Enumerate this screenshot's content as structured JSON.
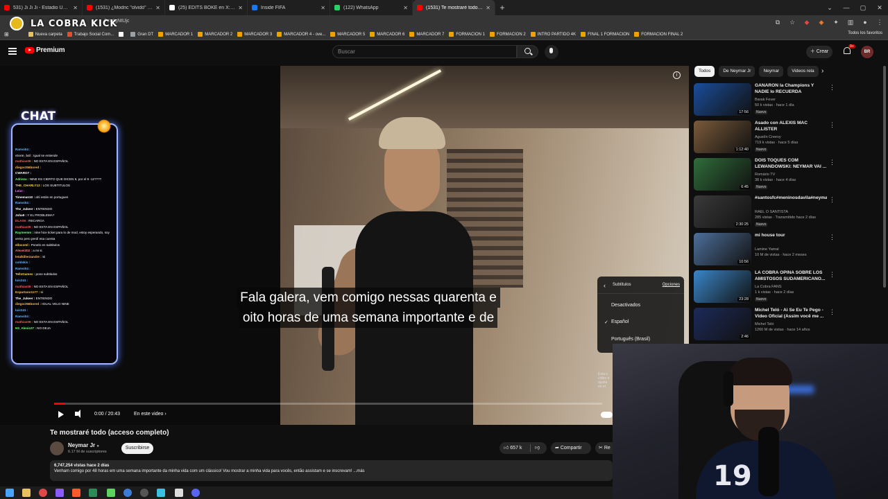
{
  "browser": {
    "tabs": [
      {
        "title": "531) Ji Ji Ji - Estadio Único de",
        "favicon_color": "#ff0000",
        "active": false
      },
      {
        "title": "(1531) ¿Modric \"olvidó\" al Madr",
        "favicon_color": "#ff0000",
        "active": false
      },
      {
        "title": "(25) EDITS BOKE en X: \"Los ocho",
        "favicon_color": "#ffffff",
        "active": false
      },
      {
        "title": "Inside FIFA",
        "favicon_color": "#1877f2",
        "active": false
      },
      {
        "title": "(122) WhatsApp",
        "favicon_color": "#25d366",
        "active": false
      },
      {
        "title": "(1531) Te mostraré todo (acceso",
        "favicon_color": "#ff0000",
        "active": true
      }
    ],
    "url_fragment": "?v=4gNtUjc",
    "bookmarks": [
      {
        "label": "Nueva carpeta",
        "color": "#e8c060"
      },
      {
        "label": "Trabajo Social Com...",
        "color": "#e0502c"
      },
      {
        "label": "",
        "color": "#ffffff"
      },
      {
        "label": "Gran DT",
        "color": "#9aa0a6"
      },
      {
        "label": "MARCADOR 1",
        "color": "#f0a000"
      },
      {
        "label": "MARCADOR 2",
        "color": "#f0a000"
      },
      {
        "label": "MARCADOR 3",
        "color": "#f0a000"
      },
      {
        "label": "MARCADOR 4 - ove...",
        "color": "#f0a000"
      },
      {
        "label": "MARCADOR 5",
        "color": "#f0a000"
      },
      {
        "label": "MARCADOR 6",
        "color": "#f0a000"
      },
      {
        "label": "MARCADOR 7",
        "color": "#f0a000"
      },
      {
        "label": "FORMACION 1",
        "color": "#f0a000"
      },
      {
        "label": "FORMACION 2",
        "color": "#f0a000"
      },
      {
        "label": "INTRO PARTIDO 4K",
        "color": "#f0a000"
      },
      {
        "label": "FINAL 1 FORMACION",
        "color": "#f0a000"
      },
      {
        "label": "FORMACION FINAL 2",
        "color": "#f0a000"
      }
    ],
    "all_bookmarks": "Todos los favoritos"
  },
  "overlay": {
    "brand": "LA COBRA KICK",
    "chat_title": "CHAT",
    "chat_lines": [
      {
        "user": "Ramsi04 :",
        "text": "",
        "color": "#69b4ff"
      },
      {
        "user": "storm_b4l :",
        "text": "Igual se entiende",
        "color": "#c9c9c9"
      },
      {
        "user": "mathias09 :",
        "text": "NO ESTA EN ESPAÑOL",
        "color": "#ff5a5a"
      },
      {
        "user": "diegoct56bored :",
        "text": "",
        "color": "#ffb84d"
      },
      {
        "user": "CWARO7 :",
        "text": "",
        "color": "#ffffff"
      },
      {
        "user": "Adrieza :",
        "text": "NINE ES CIERTO QUE DICEN 9, por el 9 -12????",
        "color": "#7cff7c"
      },
      {
        "user": "THE_CHARLY13 :",
        "text": "LOS SUBTITULOS",
        "color": "#ffd24d"
      },
      {
        "user": "Leix! :",
        "text": "",
        "color": "#ff7cff"
      },
      {
        "user": "Timeman10 :",
        "text": "ahí están en portugues",
        "color": "#ffffff"
      },
      {
        "user": "Ramsi04 :",
        "text": "",
        "color": "#69b4ff"
      },
      {
        "user": "The_Jukeer :",
        "text": "ENTIENDO",
        "color": "#ffffff"
      },
      {
        "user": "Joha9 :",
        "text": "Y EL PROBLEMA?",
        "color": "#ffffff"
      },
      {
        "user": "DLAS9 :",
        "text": "RECARGA",
        "color": "#ff5a5a"
      },
      {
        "user": "mathias09 :",
        "text": "NO ESTA EN ESPAÑOL",
        "color": "#ff5a5a"
      },
      {
        "user": "Raymemm :",
        "text": "nine hice ticket para lo de mod, estoy esperando, soy",
        "color": "#7cff7c"
      },
      {
        "user": "",
        "text": "verso pero perdí esa cuenta",
        "color": "#7cff7c"
      },
      {
        "user": "ellocoml :",
        "text": "Ponelo en subtitulos",
        "color": "#ffd24d"
      },
      {
        "user": "Alexei302 :",
        "text": "a mi si",
        "color": "#ff7c7c"
      },
      {
        "user": "letalkiller2andre :",
        "text": "Si",
        "color": "#ffb84d"
      },
      {
        "user": "coldskis :",
        "text": "",
        "color": "#69b4ff"
      },
      {
        "user": "Ramsi04 :",
        "text": "",
        "color": "#69b4ff"
      },
      {
        "user": "TellsGames :",
        "text": "pone subtitulos",
        "color": "#ffd24d"
      },
      {
        "user": "luis341 :",
        "text": "",
        "color": "#69b4ff"
      },
      {
        "user": "mathias09 :",
        "text": "NO ESTA EN ESPAÑOL",
        "color": "#ff5a5a"
      },
      {
        "user": "Espartano1177 :",
        "text": "si",
        "color": "#ffb84d"
      },
      {
        "user": "The_Jukeer :",
        "text": "ENTIENDO",
        "color": "#ffffff"
      },
      {
        "user": "diegoct56bored :",
        "text": "IGUAL VELO NINE",
        "color": "#ffb84d"
      },
      {
        "user": "luis341 :",
        "text": "",
        "color": "#69b4ff"
      },
      {
        "user": "Ramsi04 :",
        "text": "",
        "color": "#69b4ff"
      },
      {
        "user": "mathias09 :",
        "text": "NO ESTA EN ESPAÑOL",
        "color": "#ff5a5a"
      },
      {
        "user": "H3_Alexis27 :",
        "text": "NO DEJA",
        "color": "#7cff7c"
      }
    ]
  },
  "youtube": {
    "logo": "Premium",
    "search_placeholder": "Buscar",
    "create_label": "Crear",
    "notifications": "9+",
    "avatar_initials": "BR",
    "player": {
      "subtitle_line1": "Fala galera, vem comigo nessas quarenta e",
      "subtitle_line2": "oito horas de uma semana importante e de",
      "time": "0:00 / 20:43",
      "live_label": "En este video",
      "progress": 0.02,
      "subtitle_menu": {
        "header": "Subtítulos",
        "options_link": "Opciones",
        "items": [
          "Desactivados",
          "Español",
          "Português (Brasil)"
        ],
        "selected": "Español"
      },
      "side_note": "Esta o vídeo o ajusta en el"
    },
    "video": {
      "title": "Te mostraré todo (acceso completo)",
      "channel": "Neymar Jr",
      "subscribers": "6.17 M de suscriptores",
      "subscribe_label": "Suscribirse",
      "likes": "657 k",
      "share_label": "Compartir",
      "clip_label": "Re",
      "stats": "6,747,254 vistas  hace 2 días",
      "description": "Venham comigo por 48 horas em uma semana importante da minha vida com um clássico! Vou mostrar a minha vida para vocês, então assistam e se inscrevam! ...más"
    },
    "chips": [
      {
        "label": "Todos",
        "active": true
      },
      {
        "label": "De Neymar Jr",
        "active": false
      },
      {
        "label": "Neymar",
        "active": false
      },
      {
        "label": "Videos rela",
        "active": false
      }
    ],
    "recommendations": [
      {
        "title": "GANARON la Champions Y NADIE lo RECUERDA",
        "channel": "Barak Fever",
        "meta": "50 k vistas · hace 1 día",
        "badge": "Nuevo",
        "duration": "17:56",
        "thumb": "#1a4d9a"
      },
      {
        "title": "Asado con ALEXIS MAC ALLISTER",
        "channel": "Agustín Creevy",
        "meta": "719 k vistas · hace 5 días",
        "badge": "Nuevo",
        "duration": "1:12:40",
        "thumb": "#7a5a3a"
      },
      {
        "title": "DOIS TOQUES COM LEWANDOWSKI: NEYMAR VAI ...",
        "channel": "Romário TV",
        "meta": "38 k vistas · hace 4 días",
        "badge": "Nuevo",
        "duration": "6:45",
        "thumb": "#2f6d3a"
      },
      {
        "title": "#santosfc#meninosdavila#neymarjr#neymar#santosdomund...",
        "channel": "RAEL O SANTISTA",
        "meta": "285 vistas · Transmitido hace 2 días",
        "badge": "Nuevo",
        "duration": "2:30:25",
        "thumb": "#3a3a3a"
      },
      {
        "title": "mi house tour",
        "channel": "Lamine Yamal",
        "meta": "10 M de vistas · hace 2 meses",
        "badge": "",
        "duration": "10:56",
        "thumb": "#4d6f9a"
      },
      {
        "title": "LA COBRA OPINA SOBRE LOS AMISTOSOS SUDAMERICANO...",
        "channel": "La Cobra FANS",
        "meta": "1 k vistas · hace 2 días",
        "badge": "Nuevo",
        "duration": "23:28",
        "thumb": "#3a86c9"
      },
      {
        "title": "Michel Teló - Ai Se Eu Te Pego - Vídeo Oficial (Assim você me ...",
        "channel": "Michel Teló",
        "meta": "1260 M de vistas · hace 14 años",
        "badge": "",
        "duration": "2:46",
        "thumb": "#1c2a5a"
      }
    ]
  },
  "webcam": {
    "shirt_number": "19"
  }
}
